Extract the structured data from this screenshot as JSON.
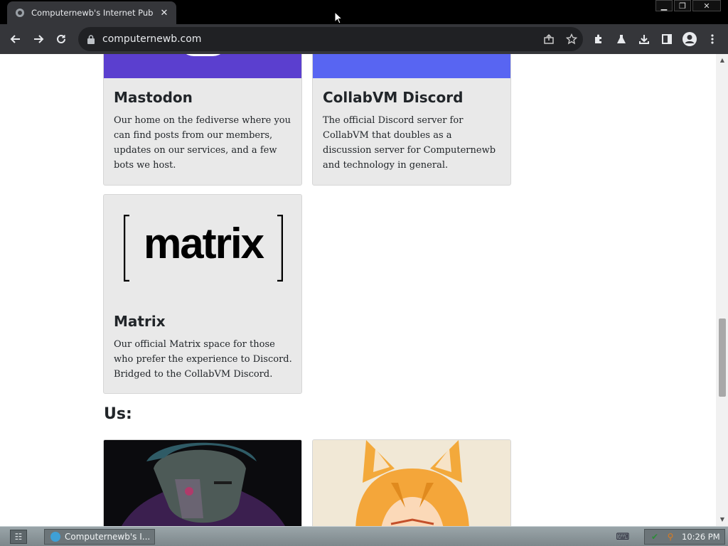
{
  "browser": {
    "tab_title": "Computernewb's Internet Pub",
    "url": "computernewb.com",
    "window_controls": {
      "minimize": "▁",
      "restore": "❐",
      "close": "✕"
    }
  },
  "page": {
    "cards_top": [
      {
        "title": "Mastodon",
        "text": "Our home on the fediverse where you can find posts from our members, updates on our services, and a few bots we host.",
        "banner_color": "#5b3fcf"
      },
      {
        "title": "CollabVM Discord",
        "text": "The official Discord server for CollabVM that doubles as a discussion server for Computernewb and technology in general.",
        "banner_color": "#5865f2"
      }
    ],
    "matrix_card": {
      "logo_text": "matrix",
      "title": "Matrix",
      "text": "Our official Matrix space for those who prefer the experience to Discord. Bridged to the CollabVM Discord."
    },
    "section_heading": "Us:"
  },
  "taskbar": {
    "task_label": "Computernewb's I...",
    "clock": "10:26 PM"
  }
}
